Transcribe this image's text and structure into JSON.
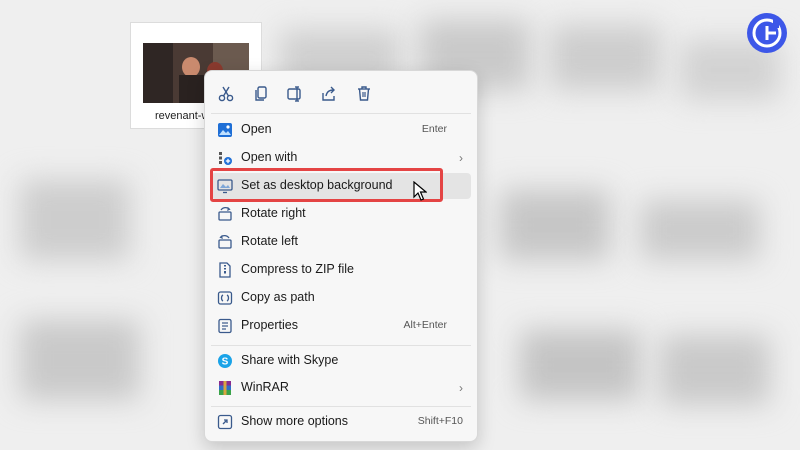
{
  "file": {
    "name": "revenant-w"
  },
  "quick_actions": [
    {
      "icon": "cut-icon"
    },
    {
      "icon": "copy-icon"
    },
    {
      "icon": "rename-icon"
    },
    {
      "icon": "share-icon"
    },
    {
      "icon": "delete-icon"
    }
  ],
  "menu": {
    "items": [
      {
        "label": "Open",
        "shortcut": "Enter",
        "icon": "photos-app-icon"
      },
      {
        "label": "Open with",
        "shortcut": "",
        "icon": "open-with-icon",
        "submenu": true
      },
      {
        "label": "Set as desktop background",
        "shortcut": "",
        "icon": "desktop-background-icon",
        "highlighted": true
      },
      {
        "label": "Rotate right",
        "shortcut": "",
        "icon": "rotate-right-icon"
      },
      {
        "label": "Rotate left",
        "shortcut": "",
        "icon": "rotate-left-icon"
      },
      {
        "label": "Compress to ZIP file",
        "shortcut": "",
        "icon": "zip-icon"
      },
      {
        "label": "Copy as path",
        "shortcut": "",
        "icon": "copy-path-icon"
      },
      {
        "label": "Properties",
        "shortcut": "Alt+Enter",
        "icon": "properties-icon"
      },
      {
        "label": "Share with Skype",
        "shortcut": "",
        "icon": "skype-icon"
      },
      {
        "label": "WinRAR",
        "shortcut": "",
        "icon": "winrar-icon",
        "submenu": true
      },
      {
        "label": "Show more options",
        "shortcut": "Shift+F10",
        "icon": "more-options-icon"
      }
    ]
  },
  "colors": {
    "highlight_box": "#e44444",
    "logo": "#3d57e8",
    "skype": "#1aa3e8"
  }
}
